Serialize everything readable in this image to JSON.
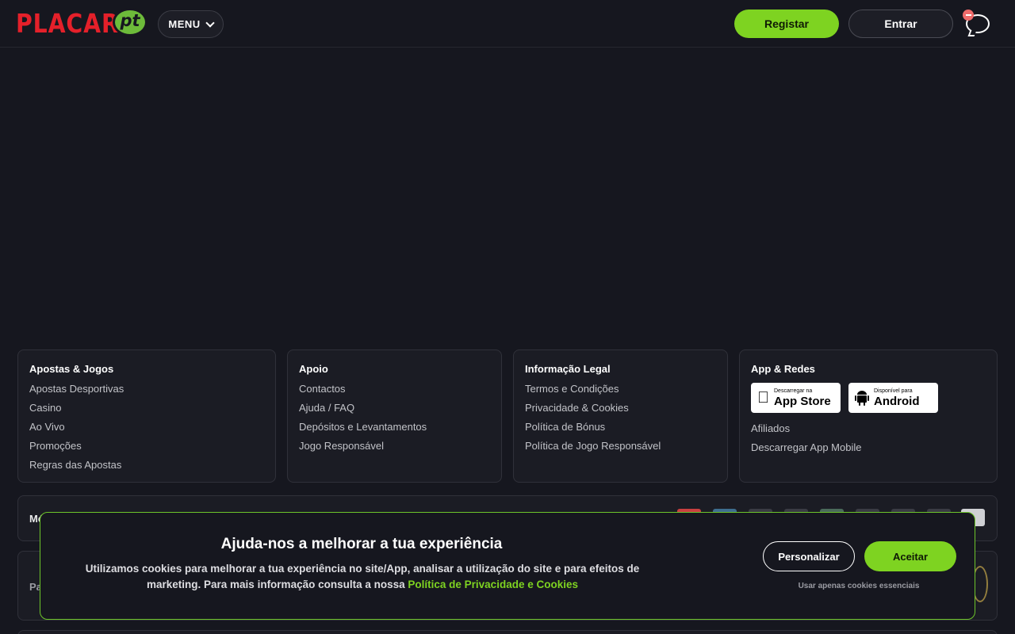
{
  "header": {
    "logo_main": "PLACARD",
    "logo_badge": "pt",
    "menu_label": "MENU",
    "register_label": "Registar",
    "login_label": "Entrar"
  },
  "footer": {
    "columns": [
      {
        "title": "Apostas & Jogos",
        "links": [
          "Apostas Desportivas",
          "Casino",
          "Ao Vivo",
          "Promoções",
          "Regras das Apostas"
        ]
      },
      {
        "title": "Apoio",
        "links": [
          "Contactos",
          "Ajuda / FAQ",
          "Depósitos e Levantamentos",
          "Jogo Responsável"
        ]
      },
      {
        "title": "Informação Legal",
        "links": [
          "Termos e Condições",
          "Privacidade & Cookies",
          "Política de Bónus",
          "Política de Jogo Responsável"
        ]
      },
      {
        "title": "App & Redes",
        "links": [
          "Afiliados",
          "Descarregar App Mobile"
        ]
      }
    ],
    "app_store": {
      "small": "Descarregar na",
      "big": "App Store"
    },
    "android": {
      "small": "Disponível para",
      "big": "Android"
    },
    "payments_label": "Mé",
    "partners_label": "Pa"
  },
  "cookie": {
    "title": "Ajuda-nos a melhorar a tua experiência",
    "text": "Utilizamos cookies para melhorar a tua experiência no site/App, analisar a utilização do site e para efeitos de marketing. Para mais informação consulta a nossa",
    "link": "Política de Privacidade e Cookies",
    "customize_label": "Personalizar",
    "accept_label": "Aceitar",
    "essential_label": "Usar apenas cookies essenciais"
  },
  "colors": {
    "accent": "#7ed321",
    "background": "#16171f",
    "logo_red": "#e4202a"
  },
  "icons": [
    "chevron-down-icon",
    "chat-icon",
    "apple-icon",
    "android-icon"
  ]
}
